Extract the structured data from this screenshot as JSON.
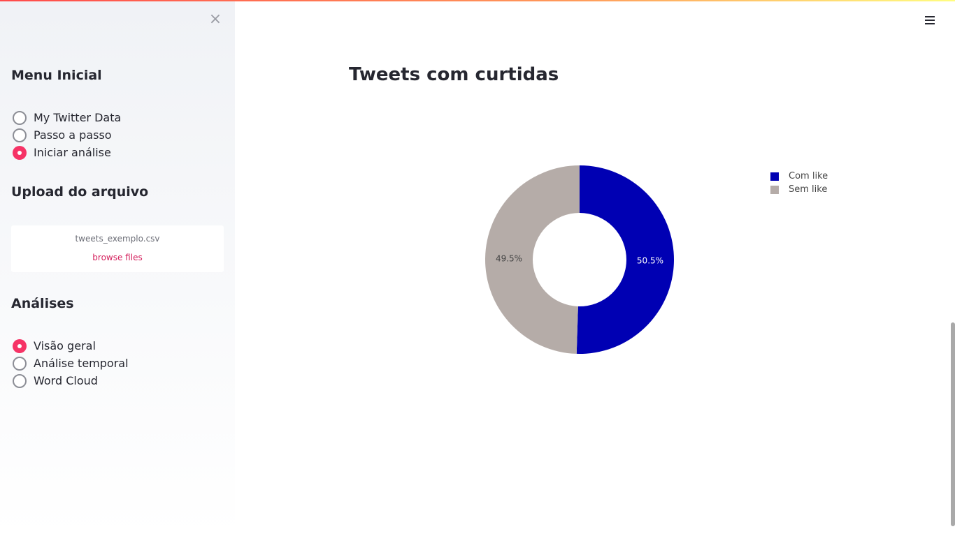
{
  "sidebar": {
    "close_label": "×",
    "menu_title": "Menu Inicial",
    "menu_options": [
      {
        "label": "My Twitter Data",
        "checked": false
      },
      {
        "label": "Passo a passo",
        "checked": false
      },
      {
        "label": "Iniciar análise",
        "checked": true
      }
    ],
    "upload_title": "Upload do arquivo",
    "upload_filename": "tweets_exemplo.csv",
    "upload_browse": "browse files",
    "analysis_title": "Análises",
    "analysis_options": [
      {
        "label": "Visão geral",
        "checked": true
      },
      {
        "label": "Análise temporal",
        "checked": false
      },
      {
        "label": "Word Cloud",
        "checked": false
      }
    ]
  },
  "main": {
    "title": "Tweets com curtidas"
  },
  "colors": {
    "accent": "#f63366",
    "com_like": "#0000b3",
    "sem_like": "#b5aca8"
  },
  "chart_data": {
    "type": "pie",
    "hole": true,
    "legend_position": "top-right",
    "slices": [
      {
        "name": "Com like",
        "value": 50.5,
        "label": "50.5%",
        "color": "#0000b3"
      },
      {
        "name": "Sem like",
        "value": 49.5,
        "label": "49.5%",
        "color": "#b5aca8"
      }
    ]
  }
}
